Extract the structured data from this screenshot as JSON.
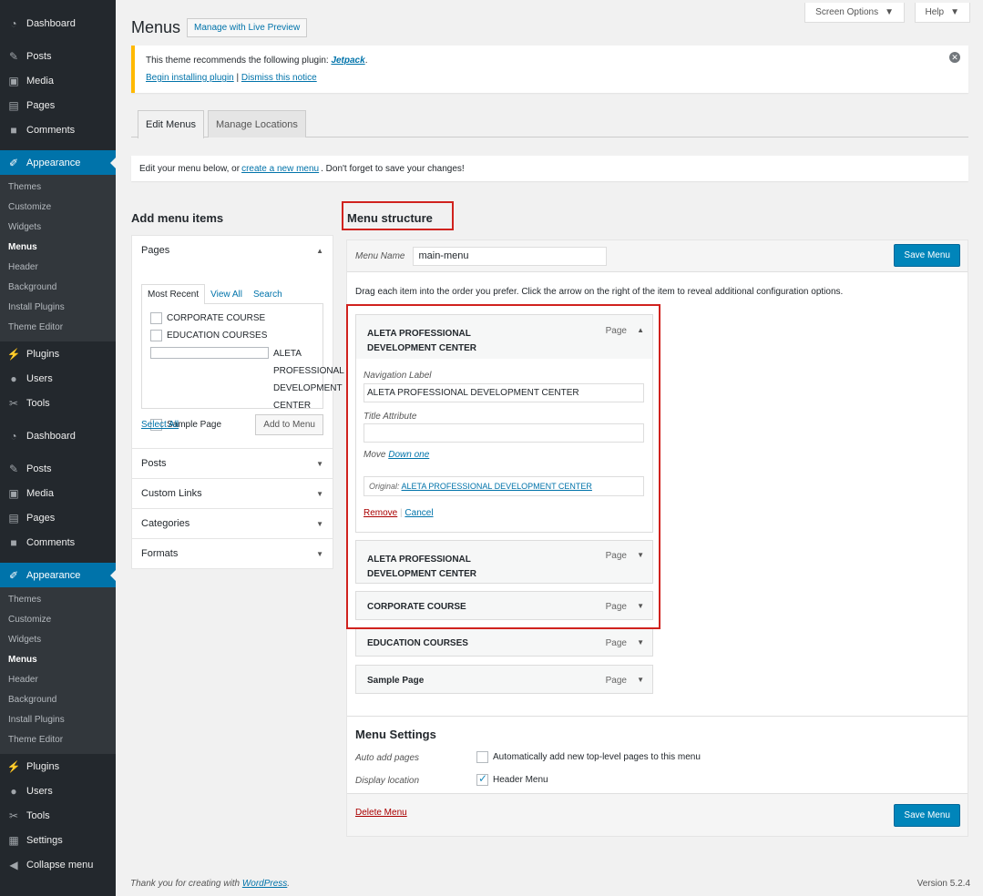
{
  "sidebar": {
    "group1": {
      "dashboard": "Dashboard",
      "posts": "Posts",
      "media": "Media",
      "pages": "Pages",
      "comments": "Comments",
      "appearance": "Appearance",
      "sub": [
        "Themes",
        "Customize",
        "Widgets",
        "Menus",
        "Header",
        "Background",
        "Install Plugins",
        "Theme Editor"
      ],
      "plugins": "Plugins",
      "users": "Users",
      "tools": "Tools"
    },
    "group2": {
      "dashboard": "Dashboard",
      "posts": "Posts",
      "media": "Media",
      "pages": "Pages",
      "comments": "Comments",
      "appearance": "Appearance",
      "sub": [
        "Themes",
        "Customize",
        "Widgets",
        "Menus",
        "Header",
        "Background",
        "Install Plugins",
        "Theme Editor"
      ],
      "plugins": "Plugins",
      "users": "Users",
      "tools": "Tools",
      "settings": "Settings",
      "collapse": "Collapse menu"
    }
  },
  "top": {
    "screen_options": "Screen Options",
    "help": "Help"
  },
  "header": {
    "title": "Menus",
    "live_preview": "Manage with Live Preview"
  },
  "notice": {
    "text": "This theme recommends the following plugin: ",
    "plugin": "Jetpack",
    "period": ".",
    "begin": "Begin installing plugin",
    "sep": " | ",
    "dismiss": "Dismiss this notice"
  },
  "tabs": {
    "edit": "Edit Menus",
    "locations": "Manage Locations"
  },
  "info": {
    "pre": "Edit your menu below, or ",
    "link": "create a new menu",
    "post": ". Don't forget to save your changes!"
  },
  "add_items": {
    "title": "Add menu items",
    "pages": "Pages",
    "mini_tabs": {
      "recent": "Most Recent",
      "all": "View All",
      "search": "Search"
    },
    "page_list": [
      "CORPORATE COURSE",
      "EDUCATION COURSES",
      "ALETA PROFESSIONAL DEVELOPMENT CENTER",
      "Sample Page"
    ],
    "select_all": "Select All",
    "add_button": "Add to Menu",
    "sections": [
      "Posts",
      "Custom Links",
      "Categories",
      "Formats"
    ]
  },
  "structure": {
    "title": "Menu structure",
    "menu_name_label": "Menu Name",
    "menu_name": "main-menu",
    "save": "Save Menu",
    "instructions": "Drag each item into the order you prefer. Click the arrow on the right of the item to reveal additional configuration options.",
    "type": "Page",
    "expanded": {
      "title": "ALETA PROFESSIONAL DEVELOPMENT CENTER",
      "nav_label_caption": "Navigation Label",
      "nav_label": "ALETA PROFESSIONAL DEVELOPMENT CENTER",
      "title_attr_caption": "Title Attribute",
      "title_attr": "",
      "move": "Move",
      "down_one": "Down one",
      "original_label": "Original:",
      "original": "ALETA PROFESSIONAL DEVELOPMENT CENTER",
      "remove": "Remove",
      "sep": " | ",
      "cancel": "Cancel"
    },
    "items": [
      "ALETA PROFESSIONAL DEVELOPMENT CENTER",
      "CORPORATE COURSE",
      "EDUCATION COURSES",
      "Sample Page"
    ]
  },
  "settings": {
    "title": "Menu Settings",
    "auto_label": "Auto add pages",
    "auto_text": "Automatically add new top-level pages to this menu",
    "auto_checked": false,
    "location_label": "Display location",
    "location_text": "Header Menu",
    "location_checked": true
  },
  "bottom": {
    "delete": "Delete Menu",
    "save": "Save Menu"
  },
  "footer": {
    "thanks": "Thank you for creating with ",
    "wp": "WordPress",
    "period": ".",
    "version": "Version 5.2.4"
  },
  "colors": {
    "sidebar": "#23282d",
    "accent": "#0073aa",
    "highlight": "#d0221e",
    "notice": "#ffb900"
  }
}
